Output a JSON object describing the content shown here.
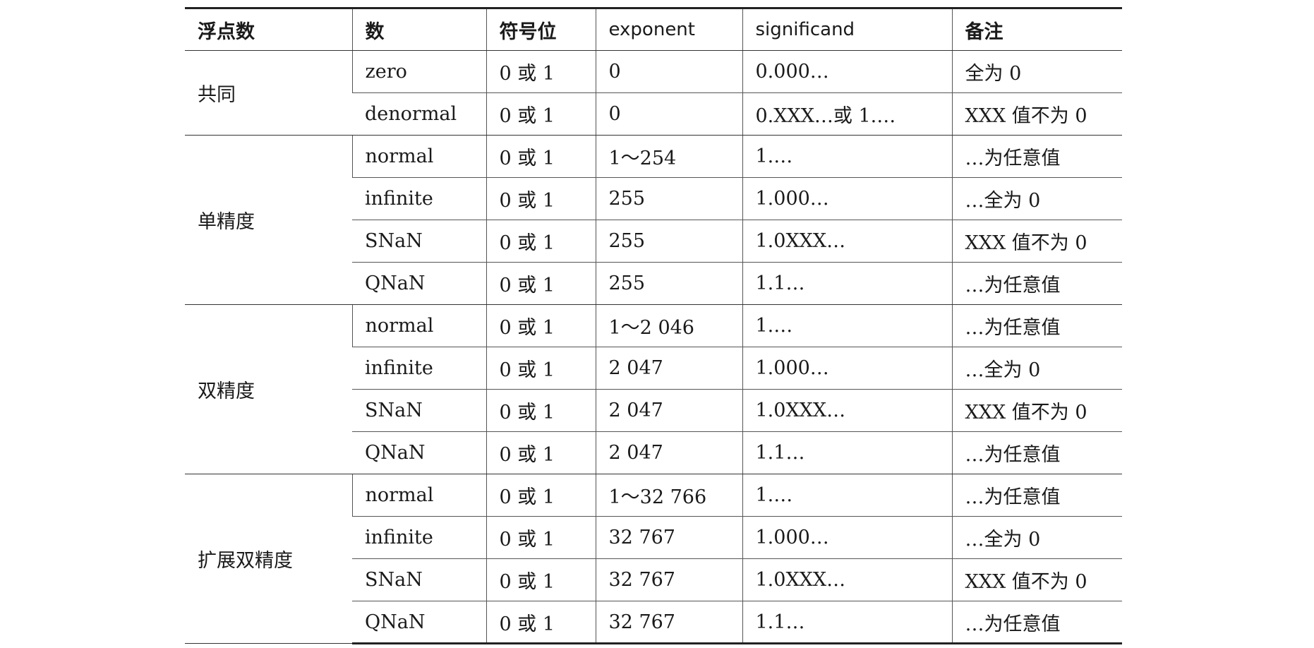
{
  "table": {
    "headers": [
      "浮点数",
      "数",
      "符号位",
      "exponent",
      "significand",
      "备注"
    ],
    "groups": [
      {
        "label": "共同",
        "rows": [
          [
            "zero",
            "0 或 1",
            "0",
            "0.000…",
            "全为 0"
          ],
          [
            "denormal",
            "0 或 1",
            "0",
            "0.XXX…或 1.…",
            "XXX 值不为 0"
          ]
        ]
      },
      {
        "label": "单精度",
        "rows": [
          [
            "normal",
            "0 或 1",
            "1～254",
            "1.…",
            "…为任意值"
          ],
          [
            "infinite",
            "0 或 1",
            "255",
            "1.000…",
            "…全为 0"
          ],
          [
            "SNaN",
            "0 或 1",
            "255",
            "1.0XXX…",
            "XXX 值不为 0"
          ],
          [
            "QNaN",
            "0 或 1",
            "255",
            "1.1…",
            "…为任意值"
          ]
        ]
      },
      {
        "label": "双精度",
        "rows": [
          [
            "normal",
            "0 或 1",
            "1～2 046",
            "1.…",
            "…为任意值"
          ],
          [
            "infinite",
            "0 或 1",
            "2 047",
            "1.000…",
            "…全为 0"
          ],
          [
            "SNaN",
            "0 或 1",
            "2 047",
            "1.0XXX…",
            "XXX 值不为 0"
          ],
          [
            "QNaN",
            "0 或 1",
            "2 047",
            "1.1…",
            "…为任意值"
          ]
        ]
      },
      {
        "label": "扩展双精度",
        "rows": [
          [
            "normal",
            "0 或 1",
            "1～32 766",
            "1.…",
            "…为任意值"
          ],
          [
            "infinite",
            "0 或 1",
            "32 767",
            "1.000…",
            "…全为 0"
          ],
          [
            "SNaN",
            "0 或 1",
            "32 767",
            "1.0XXX…",
            "XXX 值不为 0"
          ],
          [
            "QNaN",
            "0 或 1",
            "32 767",
            "1.1…",
            "…为任意值"
          ]
        ]
      }
    ]
  }
}
